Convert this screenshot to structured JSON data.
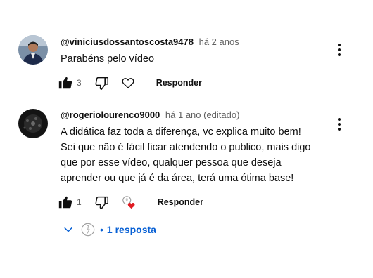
{
  "comments": [
    {
      "author": "@viniciusdossantoscosta9478",
      "time": "há 2 anos",
      "text_lines": [
        "Parabéns pelo vídeo"
      ],
      "likes": "3",
      "reply_label": "Responder"
    },
    {
      "author": "@rogeriolourenco9000",
      "time": "há 1 ano (editado)",
      "text_lines": [
        "A didática faz toda a diferença, vc explica muito bem!",
        "Sei que não é fácil ficar atendendo o publico, mais digo",
        "que por esse vídeo, qualquer pessoa que deseja",
        "aprender ou que já é da área, terá uma ótima base!"
      ],
      "likes": "1",
      "reply_label": "Responder"
    }
  ],
  "replies_toggle": {
    "label": "1 resposta",
    "separator": "•"
  },
  "colors": {
    "link": "#065fd4",
    "heart": "#e01b22",
    "secondary_text": "#606060"
  },
  "icons": [
    "like-icon",
    "dislike-icon",
    "heart-icon",
    "creator-heart-icon",
    "more-vert-icon",
    "chevron-down-icon",
    "channel-avatar-icon"
  ]
}
